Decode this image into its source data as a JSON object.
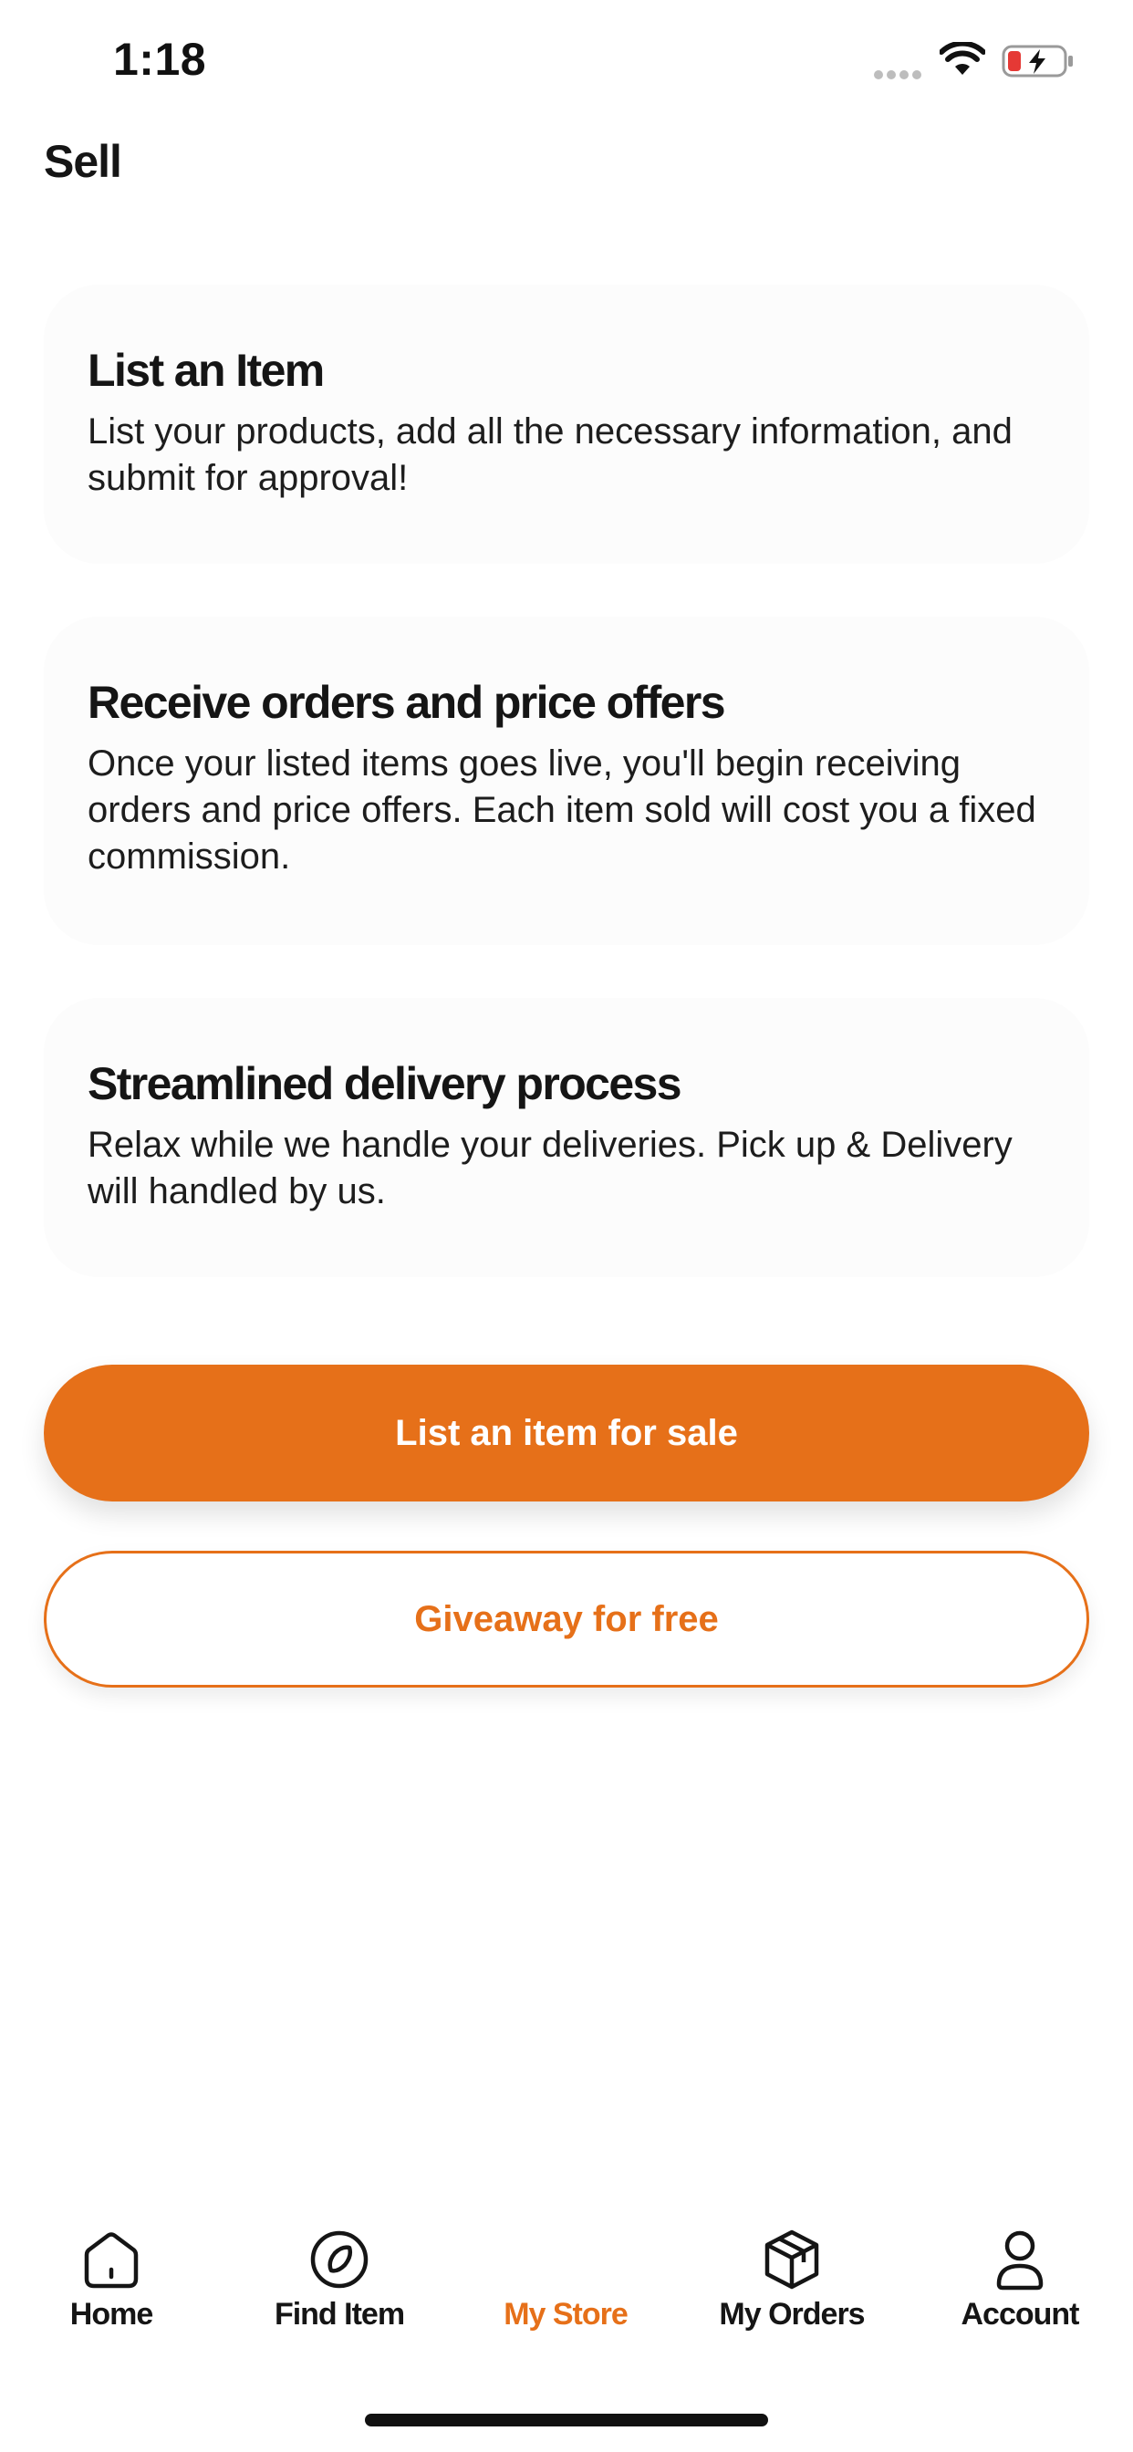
{
  "status_bar": {
    "time": "1:18"
  },
  "header": {
    "title": "Sell"
  },
  "cards": [
    {
      "title": "List an Item",
      "text": "List your products, add all the necessary information, and submit for approval!"
    },
    {
      "title": "Receive orders and price offers",
      "text": "Once your listed items goes live, you'll begin receiving orders and price offers. Each item sold will cost you a fixed commission."
    },
    {
      "title": "Streamlined delivery process",
      "text": "Relax while we handle your deliveries. Pick up & Delivery will handled by us."
    }
  ],
  "actions": {
    "primary_label": "List an item for sale",
    "secondary_label": "Giveaway for free"
  },
  "tab_bar": {
    "items": [
      {
        "label": "Home",
        "icon": "house-icon"
      },
      {
        "label": "Find Item",
        "icon": "compass-icon"
      },
      {
        "label": "My Store",
        "icon": "store-icon"
      },
      {
        "label": "My Orders",
        "icon": "box-icon"
      },
      {
        "label": "Account",
        "icon": "person-icon"
      }
    ],
    "active": "My Store"
  },
  "colors": {
    "accent": "#e67019",
    "text": "#151515",
    "card_bg": "#fcfcfc",
    "background": "#ffffff"
  }
}
